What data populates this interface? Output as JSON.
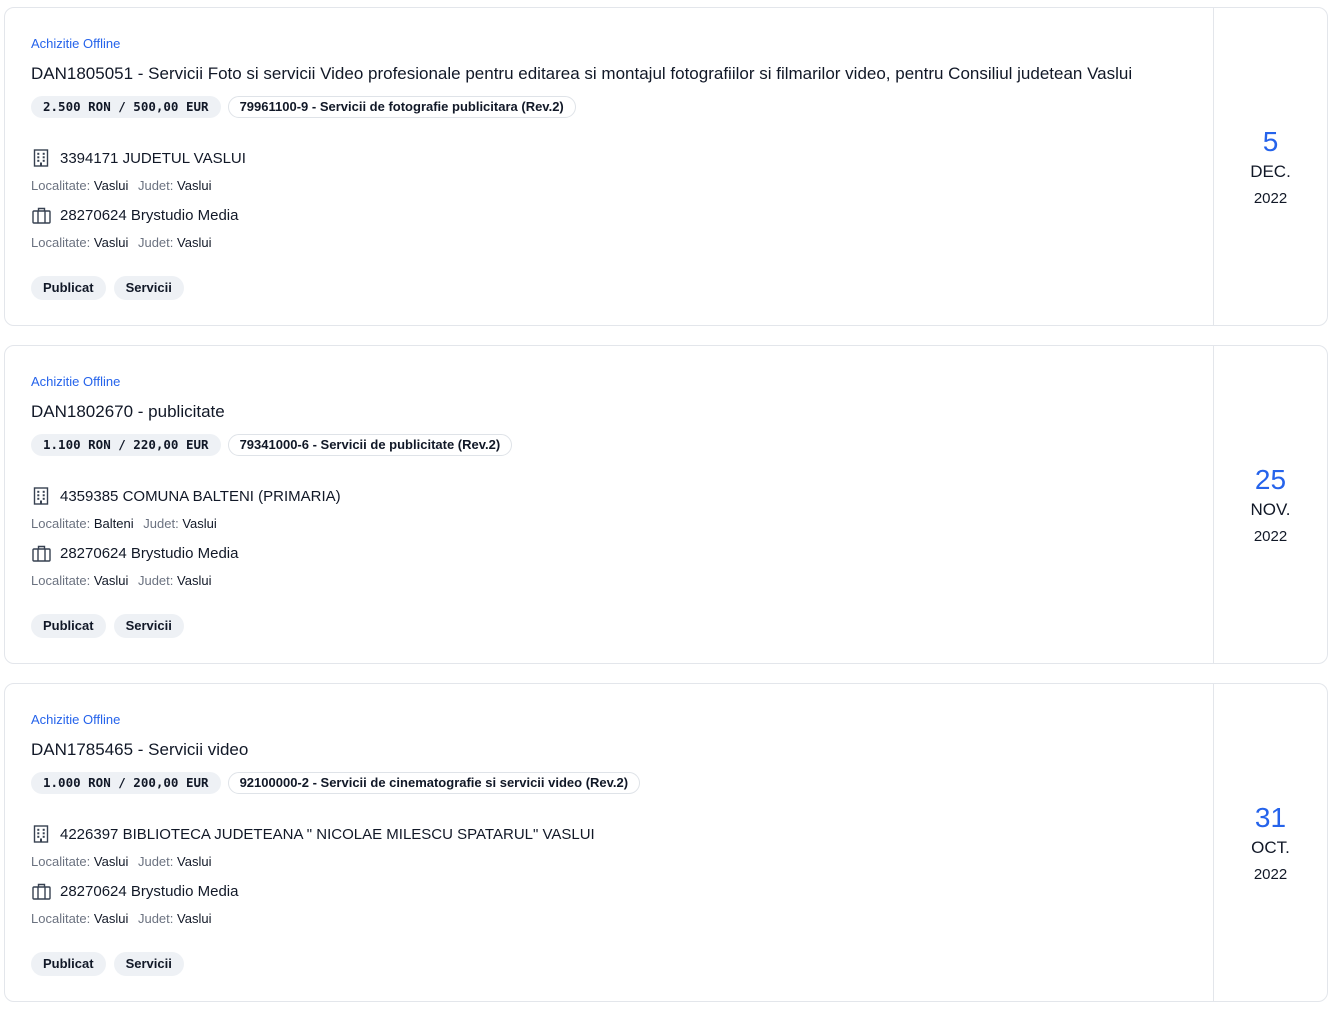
{
  "cards": [
    {
      "type": "Achizitie Offline",
      "title": "DAN1805051 - Servicii Foto si servicii Video profesionale pentru editarea si montajul fotografiilor si filmarilor video, pentru Consiliul judetean Vaslui",
      "value": "2.500 RON / 500,00 EUR",
      "cpv": "79961100-9 - Servicii de fotografie publicitara (Rev.2)",
      "authority": {
        "name": "3394171 JUDETUL VASLUI",
        "icon": "building-icon",
        "localitate_label": "Localitate:",
        "localitate": "Vaslui",
        "judet_label": "Judet:",
        "judet": "Vaslui"
      },
      "supplier": {
        "name": "28270624 Brystudio Media",
        "icon": "briefcase-icon",
        "localitate_label": "Localitate:",
        "localitate": "Vaslui",
        "judet_label": "Judet:",
        "judet": "Vaslui"
      },
      "tags": [
        "Publicat",
        "Servicii"
      ],
      "date": {
        "day": "5",
        "month": "DEC.",
        "year": "2022"
      }
    },
    {
      "type": "Achizitie Offline",
      "title": "DAN1802670 - publicitate",
      "value": "1.100 RON / 220,00 EUR",
      "cpv": "79341000-6 - Servicii de publicitate (Rev.2)",
      "authority": {
        "name": "4359385 COMUNA BALTENI (PRIMARIA)",
        "icon": "building-icon",
        "localitate_label": "Localitate:",
        "localitate": "Balteni",
        "judet_label": "Judet:",
        "judet": "Vaslui"
      },
      "supplier": {
        "name": "28270624 Brystudio Media",
        "icon": "briefcase-icon",
        "localitate_label": "Localitate:",
        "localitate": "Vaslui",
        "judet_label": "Judet:",
        "judet": "Vaslui"
      },
      "tags": [
        "Publicat",
        "Servicii"
      ],
      "date": {
        "day": "25",
        "month": "NOV.",
        "year": "2022"
      }
    },
    {
      "type": "Achizitie Offline",
      "title": "DAN1785465 - Servicii video",
      "value": "1.000 RON / 200,00 EUR",
      "cpv": "92100000-2 - Servicii de cinematografie si servicii video (Rev.2)",
      "authority": {
        "name": "4226397 BIBLIOTECA JUDETEANA \" NICOLAE MILESCU SPATARUL\" VASLUI",
        "icon": "building-icon",
        "localitate_label": "Localitate:",
        "localitate": "Vaslui",
        "judet_label": "Judet:",
        "judet": "Vaslui"
      },
      "supplier": {
        "name": "28270624 Brystudio Media",
        "icon": "briefcase-icon",
        "localitate_label": "Localitate:",
        "localitate": "Vaslui",
        "judet_label": "Judet:",
        "judet": "Vaslui"
      },
      "tags": [
        "Publicat",
        "Servicii"
      ],
      "date": {
        "day": "31",
        "month": "OCT.",
        "year": "2022"
      }
    }
  ],
  "colors": {
    "accent": "#2563eb",
    "border": "#e3e6eb",
    "pill_bg": "#eef1f5",
    "text": "#111827",
    "muted": "#6b7280"
  }
}
